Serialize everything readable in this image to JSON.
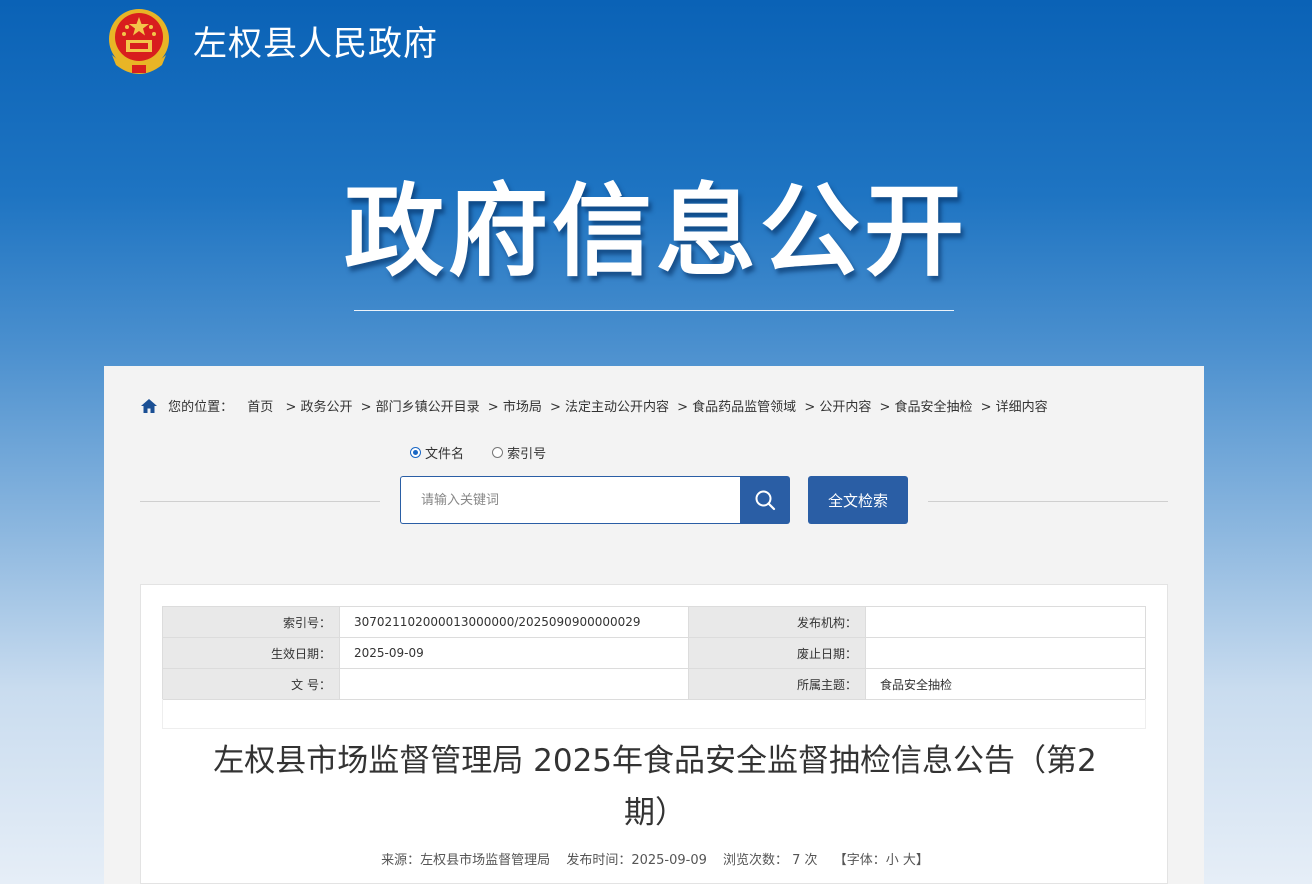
{
  "header": {
    "site_name": "左权县人民政府",
    "hero_title": "政府信息公开"
  },
  "breadcrumb": {
    "prefix": "您的位置：",
    "items": [
      "首页",
      "> 政务公开",
      "> 部门乡镇公开目录",
      "> 市场局",
      "> 法定主动公开内容",
      "> 食品药品监管领域",
      "> 公开内容",
      "> 食品安全抽检",
      "> 详细内容"
    ]
  },
  "search": {
    "radio_filename": "文件名",
    "radio_index": "索引号",
    "selected": "文件名",
    "placeholder": "请输入关键词",
    "fulltext_label": "全文检索"
  },
  "meta": {
    "index_key": "索引号：",
    "index_value": "307021102000013000000/2025090900000029",
    "org_key": "发布机构：",
    "org_value": "",
    "effective_key": "生效日期：",
    "effective_value": "2025-09-09",
    "expire_key": "废止日期：",
    "expire_value": "",
    "docno_key": "文 号：",
    "docno_value": "",
    "topic_key": "所属主题：",
    "topic_value": "食品安全抽检"
  },
  "article": {
    "title": "左权县市场监督管理局 2025年食品安全监督抽检信息公告（第2期）",
    "source": "来源：左权县市场监督管理局",
    "published": "发布时间：2025-09-09",
    "views": "浏览次数： 7  次",
    "font_size": "【字体：小 大】"
  },
  "colors": {
    "primary": "#2a5ea5",
    "header_top": "#0a62b6"
  }
}
